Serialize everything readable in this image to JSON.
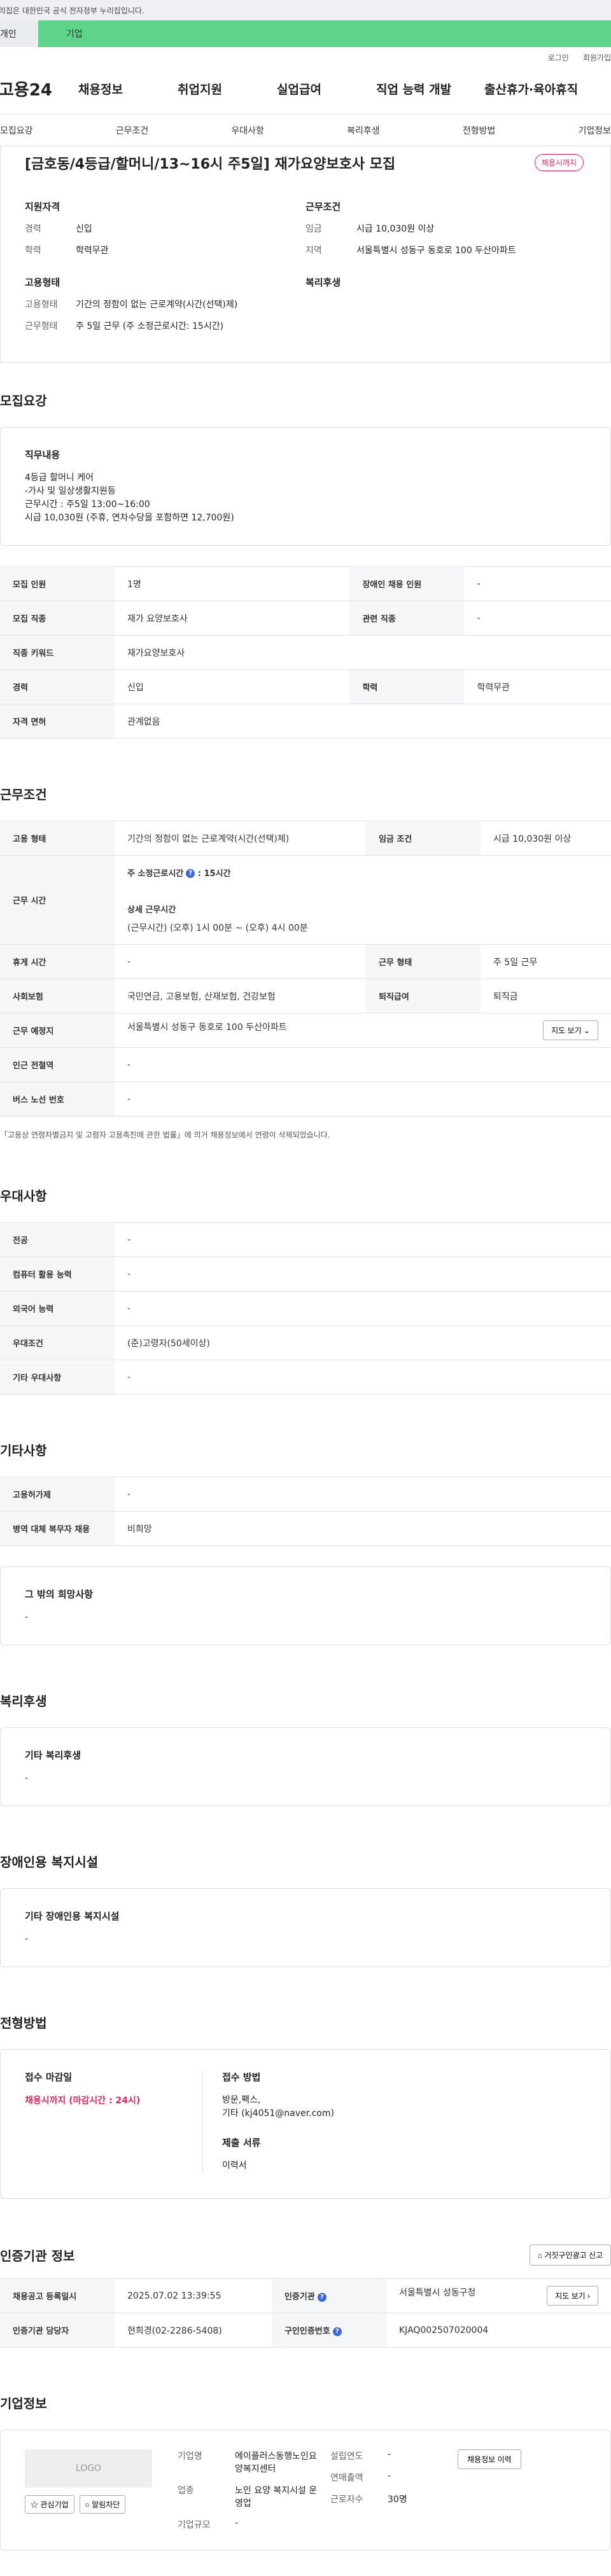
{
  "gov_banner": "이 누리집은 대한민국 공식 전자정부 누리집입니다.",
  "top_tabs": {
    "personal": "개인",
    "biz": "기업"
  },
  "util": [
    "로그인",
    "회원가입"
  ],
  "gnb": {
    "logo": "고용24",
    "menu": [
      "채용정보",
      "취업지원",
      "실업급여",
      "직업 능력 개발",
      "출산휴가·육아휴직"
    ]
  },
  "subnav": [
    "모집요강",
    "근무조건",
    "우대사항",
    "복리후생",
    "전형방법",
    "기업정보"
  ],
  "job": {
    "title": "[금호동/4등급/할머니/13~16시 주5일] 재가요양보호사 모집",
    "badge": "채용시까지",
    "qual_h": "지원자격",
    "qual": [
      [
        "경력",
        "신입"
      ],
      [
        "학력",
        "학력무관"
      ]
    ],
    "cond_h": "근무조건",
    "cond": [
      [
        "임금",
        "시급 10,030원 이상"
      ],
      [
        "지역",
        "서울특별시 성동구 동호로 100 두산아파트"
      ]
    ],
    "emp_h": "고용형태",
    "emp": [
      [
        "고용형태",
        "기간의 정함이 없는 근로계약(시간(선택)제)"
      ],
      [
        "근무형태",
        "주 5일 근무 (주 소정근로시간: 15시간)"
      ]
    ],
    "welfare_h": "복리후생"
  },
  "recruit": {
    "title": "모집요강",
    "duty_h": "직무내용",
    "duty": [
      "4등급 할머니 케어",
      "-가사 및 일상생활지원등",
      "근무시간 : 주5일 13:00~16:00",
      "시급 10,030원 (주휴, 연차수당을 포함하면 12,700원)"
    ],
    "rows": [
      [
        "모집 인원",
        "1명",
        "장애인 채용 인원",
        "-"
      ],
      [
        "모집 직종",
        "재가 요양보호사",
        "관련 직종",
        "-"
      ],
      [
        "직종 키워드",
        "재가요양보호사"
      ],
      [
        "경력",
        "신입",
        "학력",
        "학력무관"
      ],
      [
        "자격 면허",
        "관계없음"
      ]
    ]
  },
  "work": {
    "title": "근무조건",
    "emp_type_k": "고용 형태",
    "emp_type_v": "기간의 정함이 없는 근로계약(시간(선택)제)",
    "wage_k": "임금 조건",
    "wage_v": "시급 10,030원 이상",
    "hours_k": "근무 시간",
    "hours_1": "주 소정근로시간",
    "hours_1v": ": 15시간",
    "hours_2": "상세 근무시간",
    "hours_2v": "(근무시간) (오후) 1시 00분 ~ (오후) 4시 00분",
    "rows2": [
      [
        "휴게 시간",
        "-",
        "근무 형태",
        "주 5일 근무"
      ],
      [
        "사회보험",
        "국민연금, 고용보험, 산재보험, 건강보험",
        "퇴직급여",
        "퇴직금"
      ]
    ],
    "place_k": "근무 예정지",
    "place_v": "서울특별시 성동구 동호로 100 두산아파트",
    "map_btn": "지도 보기",
    "rows3": [
      [
        "인근 전철역",
        "-"
      ],
      [
        "버스 노선 번호",
        "-"
      ]
    ],
    "note": "「고용상 연령차별금지 및 고령자 고용촉진에 관한 법률」에 의거 채용정보에서 연령이 삭제되었습니다."
  },
  "pref": {
    "title": "우대사항",
    "rows": [
      [
        "전공",
        "-"
      ],
      [
        "컴퓨터 활용 능력",
        "-"
      ],
      [
        "외국어 능력",
        "-"
      ],
      [
        "우대조건",
        "(준)고령자(50세이상)"
      ],
      [
        "기타 우대사항",
        "-"
      ]
    ]
  },
  "etc": {
    "title": "기타사항",
    "rows": [
      [
        "고용허가제",
        "-"
      ],
      [
        "병역 대체 복무자 채용",
        "비희망"
      ]
    ],
    "card_h": "그 밖의 희망사항",
    "card_v": "-"
  },
  "welfare": {
    "title": "복리후생",
    "card_h": "기타 복리후생",
    "card_v": "-"
  },
  "disab": {
    "title": "장애인용 복지시설",
    "card_h": "기타 장애인용 복지시설",
    "card_v": "-"
  },
  "process": {
    "title": "전형방법",
    "deadline_h": "접수 마감일",
    "deadline_v": "채용시까지 (마감시간 : 24시)",
    "method_h": "접수 방법",
    "method_v": [
      "방문,팩스,",
      "기타 (kj4051@naver.com)"
    ],
    "docs_h": "제출 서류",
    "docs_v": "이력서"
  },
  "agency": {
    "title": "인증기관 정보",
    "report_btn": "거짓구인광고 신고",
    "rows": [
      [
        "채용공고 등록일시",
        "2025.07.02 13:39:55",
        "인증기관",
        "서울특별시 성동구청"
      ],
      [
        "인증기관 담당자",
        "현희경(02-2286-5408)",
        "구인인증번호",
        "KJAQ002507020004"
      ]
    ],
    "map_btn": "지도 보기"
  },
  "company": {
    "title": "기업정보",
    "logo": "LOGO",
    "btn_fav": "관심기업",
    "btn_alarm": "알림차단",
    "btn_jobs": "채용정보 이력",
    "name_k": "기업명",
    "name_v": "에이플러스동행노인요양복지센터",
    "biz_k": "업종",
    "biz_v": "노인 요양 복지시설 운영업",
    "size_k": "기업규모",
    "size_v": "-",
    "est_k": "설립연도",
    "est_v": "-",
    "rev_k": "연매출액",
    "rev_v": "-",
    "emp_k": "근로자수",
    "emp_v": "30명"
  }
}
